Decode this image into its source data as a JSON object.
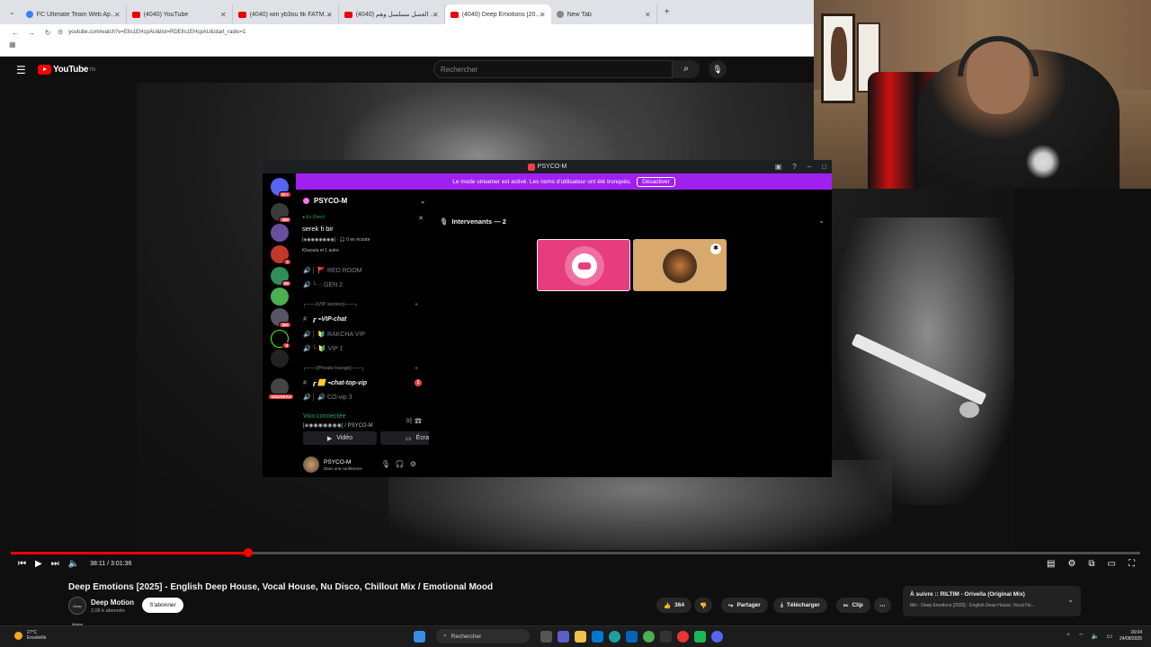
{
  "browser": {
    "tabs": [
      {
        "title": "FC Ultimate Team Web App - E",
        "fav": "blue"
      },
      {
        "title": "(4040) YouTube",
        "fav": "yt"
      },
      {
        "title": "(4040) win yb3ou fik FATMA B",
        "fav": "yt"
      },
      {
        "title": "(4040) شهر العسل مسلسل وهم",
        "fav": "yt"
      },
      {
        "title": "(4040) Deep Emotions [2025]",
        "fav": "yt",
        "active": true
      },
      {
        "title": "New Tab",
        "fav": "gray"
      }
    ],
    "new_tab": "+",
    "url": "youtube.com/watch?v=ElIs1EHcpAU&list=RDElIs1EHcpAU&start_radio=1"
  },
  "youtube": {
    "logo": "YouTube",
    "logo_sup": "TN",
    "search_placeholder": "Rechercher"
  },
  "discord": {
    "window_title": "PSYCO-M",
    "banner_text": "Le mode streamer est activé. Les noms d'utilisateur ont été tronqués.",
    "banner_button": "Désactiver",
    "server_name": "PSYCO-M",
    "live_label": "● En Direct",
    "live_title": "serek fi bir",
    "live_sub": "[◈◉◉◉◉◉◉◉] · 🎧 0 en écoute",
    "live_sub2": "Khaoula et 1 autre",
    "channels": [
      {
        "icon": "🔊",
        "name": "│ 🚩 RED ROOM",
        "style": "normal"
      },
      {
        "icon": "🔊",
        "name": "└ ◌ GEN 2",
        "style": "normal"
      },
      {
        "icon": "",
        "name": "╭───[VIP section]───╮",
        "style": "cat"
      },
      {
        "icon": "#",
        "name": "┎ ⌁VIP-chat",
        "style": "bold"
      },
      {
        "icon": "🔊",
        "name": "│ 🔰 RAKCHA VIP",
        "style": "normal"
      },
      {
        "icon": "🔊",
        "name": "└ 🔰 VIP 1",
        "style": "normal"
      },
      {
        "icon": "",
        "name": "╭───[Private lounge]───╮",
        "style": "cat"
      },
      {
        "icon": "#",
        "name": "┎ 🟨 ⌁chat-top-vip",
        "style": "bold",
        "unread": "1"
      },
      {
        "icon": "🔊",
        "name": "│ 🔊 CO-vip 3",
        "style": "normal"
      }
    ],
    "voice_connected": "Voix connectée",
    "voice_channel": "[◈◉◉◉◉◉◉◉] / PSYCO-M",
    "video_btn": "Vidéo",
    "screen_btn": "Écran",
    "username": "PSYCO-M",
    "user_status": "Dans une conférence",
    "stage_header": "Intervenants — 2",
    "guild_badges": [
      "1K+",
      "488",
      "1",
      "69",
      "",
      "291",
      "3",
      "",
      "NOUVEAU"
    ]
  },
  "player": {
    "time": "38:11 / 3:01:36",
    "progress": 0.21
  },
  "video": {
    "title": "Deep Emotions [2025] - English Deep House, Vocal House, Nu Disco, Chillout Mix / Emotional Mood",
    "channel": "Deep Motion",
    "channel_avatar_text": "Deep Motion",
    "subs": "2,06 k abonnés",
    "subscribe": "S'abonner",
    "likes": "364",
    "share": "Partager",
    "download": "Télécharger",
    "clip": "Clip",
    "up_next": "À suivre :: RILTIM - Orivella (Original Mix)",
    "up_next_sub": "Mix - Deep Emotions [2025] - English Deep House, Vocal Ho..."
  },
  "taskbar": {
    "temp": "27°C",
    "weather": "Ensoleillé",
    "search": "Rechercher",
    "time": "16:04",
    "date": "24/08/2025"
  }
}
